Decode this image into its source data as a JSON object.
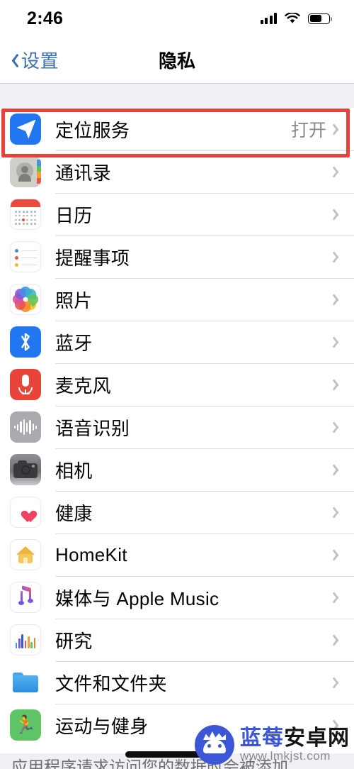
{
  "status_bar": {
    "time": "2:46",
    "signal_icon": "cellular-signal-icon",
    "wifi_icon": "wifi-icon",
    "battery_icon": "battery-icon"
  },
  "nav": {
    "back_label": "设置",
    "back_icon": "chevron-left-icon",
    "title": "隐私"
  },
  "highlight": {
    "color": "#e8413c",
    "target": "定位服务"
  },
  "list": {
    "rows": [
      {
        "label": "定位服务",
        "value": "打开",
        "icon": "location-services-icon"
      },
      {
        "label": "通讯录",
        "value": "",
        "icon": "contacts-icon"
      },
      {
        "label": "日历",
        "value": "",
        "icon": "calendar-icon"
      },
      {
        "label": "提醒事项",
        "value": "",
        "icon": "reminders-icon"
      },
      {
        "label": "照片",
        "value": "",
        "icon": "photos-icon"
      },
      {
        "label": "蓝牙",
        "value": "",
        "icon": "bluetooth-icon"
      },
      {
        "label": "麦克风",
        "value": "",
        "icon": "microphone-icon"
      },
      {
        "label": "语音识别",
        "value": "",
        "icon": "speech-recognition-icon"
      },
      {
        "label": "相机",
        "value": "",
        "icon": "camera-icon"
      },
      {
        "label": "健康",
        "value": "",
        "icon": "health-icon"
      },
      {
        "label": "HomeKit",
        "value": "",
        "icon": "homekit-icon"
      },
      {
        "label": "媒体与 Apple Music",
        "value": "",
        "icon": "apple-music-icon"
      },
      {
        "label": "研究",
        "value": "",
        "icon": "research-icon"
      },
      {
        "label": "文件和文件夹",
        "value": "",
        "icon": "files-and-folders-icon"
      },
      {
        "label": "运动与健身",
        "value": "",
        "icon": "fitness-icon"
      }
    ]
  },
  "footer": {
    "note": "应用程序请求访问您的数据时会被添加"
  },
  "watermark": {
    "brand_blue": "蓝莓",
    "brand_dark": "安卓网",
    "url": "www.lmkjst.com",
    "logo_icon": "android-robot-logo-icon"
  }
}
